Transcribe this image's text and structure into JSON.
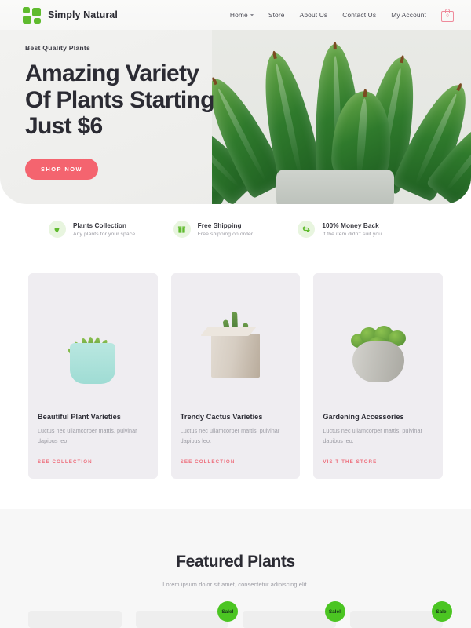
{
  "header": {
    "brand_name": "Simply Natural",
    "logo_icon": "four-squares-logo",
    "nav": [
      {
        "label": "Home",
        "has_dropdown": true
      },
      {
        "label": "Store",
        "has_dropdown": false
      },
      {
        "label": "About Us",
        "has_dropdown": false
      },
      {
        "label": "Contact Us",
        "has_dropdown": false
      },
      {
        "label": "My Account",
        "has_dropdown": false
      }
    ],
    "cart": {
      "icon": "shopping-bag-icon",
      "count": "0",
      "color": "#ef8a9b"
    }
  },
  "hero": {
    "eyebrow": "Best Quality Plants",
    "title_line1": "Amazing Variety",
    "title_line2": "Of Plants Starting",
    "title_line3": "Just $6",
    "cta_label": "SHOP NOW",
    "cta_color": "#f4646f",
    "image_alt": "succulent-plant-photo"
  },
  "features": [
    {
      "icon": "leaf-icon",
      "title": "Plants Collection",
      "subtitle": "Any plants for your space"
    },
    {
      "icon": "box-icon",
      "title": "Free Shipping",
      "subtitle": "Free shipping on order"
    },
    {
      "icon": "refresh-icon",
      "title": "100% Money Back",
      "subtitle": "If the item didn't suit you"
    }
  ],
  "category_cards": [
    {
      "title": "Beautiful Plant Varieties",
      "text": "Luctus nec ullamcorper mattis, pulvinar dapibus leo.",
      "link_label": "SEE COLLECTION",
      "image_alt": "aloe-succulent-in-mint-pot"
    },
    {
      "title": "Trendy Cactus Varieties",
      "text": "Luctus nec ullamcorper mattis, pulvinar dapibus leo.",
      "link_label": "SEE COLLECTION",
      "image_alt": "cactus-in-beige-cube-pot"
    },
    {
      "title": "Gardening Accessories",
      "text": "Luctus nec ullamcorper mattis, pulvinar dapibus leo.",
      "link_label": "VISIT THE STORE",
      "image_alt": "moss-plant-in-concrete-pot"
    }
  ],
  "featured": {
    "title": "Featured Plants",
    "subtitle": "Lorem ipsum dolor sit amet, consectetur adipiscing elit.",
    "products": [
      {
        "sale_badge": ""
      },
      {
        "sale_badge": "Sale!"
      },
      {
        "sale_badge": "Sale!"
      },
      {
        "sale_badge": "Sale!"
      }
    ]
  },
  "theme": {
    "accent_pink": "#f4646f",
    "accent_green": "#5fbb2e",
    "sale_green": "#4bc522",
    "text_dark": "#2b2b33",
    "text_muted": "#9b9ba3"
  }
}
